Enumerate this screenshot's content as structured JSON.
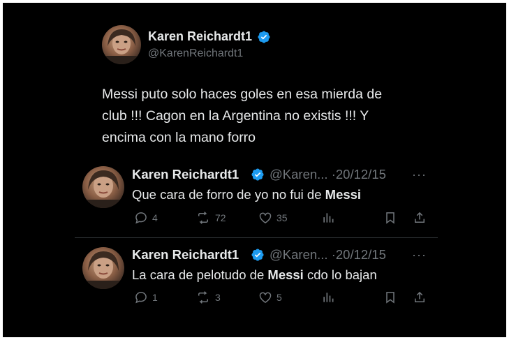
{
  "main_tweet": {
    "author_name": "Karen Reichardt1",
    "handle": "@KarenReichardt1",
    "text_lines": [
      "Messi puto solo haces goles en esa mierda de",
      "club !!! Cagon  en la Argentina no existis !!! Y",
      "encima con la mano forro"
    ]
  },
  "replies": [
    {
      "author_name": "Karen Reichardt1",
      "handle": "@Karen...",
      "separator": "·",
      "date": "20/12/15",
      "more": "···",
      "text_before": "Que cara de forro de yo no fui de ",
      "text_bold": "Messi",
      "text_after": "",
      "replies_count": "4",
      "reposts_count": "72",
      "likes_count": "35"
    },
    {
      "author_name": "Karen Reichardt1",
      "handle": "@Karen...",
      "separator": "·",
      "date": "20/12/15",
      "more": "···",
      "text_before": "La cara de pelotudo de ",
      "text_bold": "Messi",
      "text_after": " cdo lo bajan",
      "replies_count": "1",
      "reposts_count": "3",
      "likes_count": "5"
    }
  ],
  "icons": {
    "verified": "verified-badge-icon",
    "reply": "reply-icon",
    "repost": "repost-icon",
    "like": "like-icon",
    "views": "views-icon",
    "bookmark": "bookmark-icon",
    "share": "share-icon"
  },
  "colors": {
    "background": "#000000",
    "text": "#e7e9ea",
    "muted": "#71767b",
    "verified": "#1d9bf0",
    "divider": "#2f3336"
  }
}
